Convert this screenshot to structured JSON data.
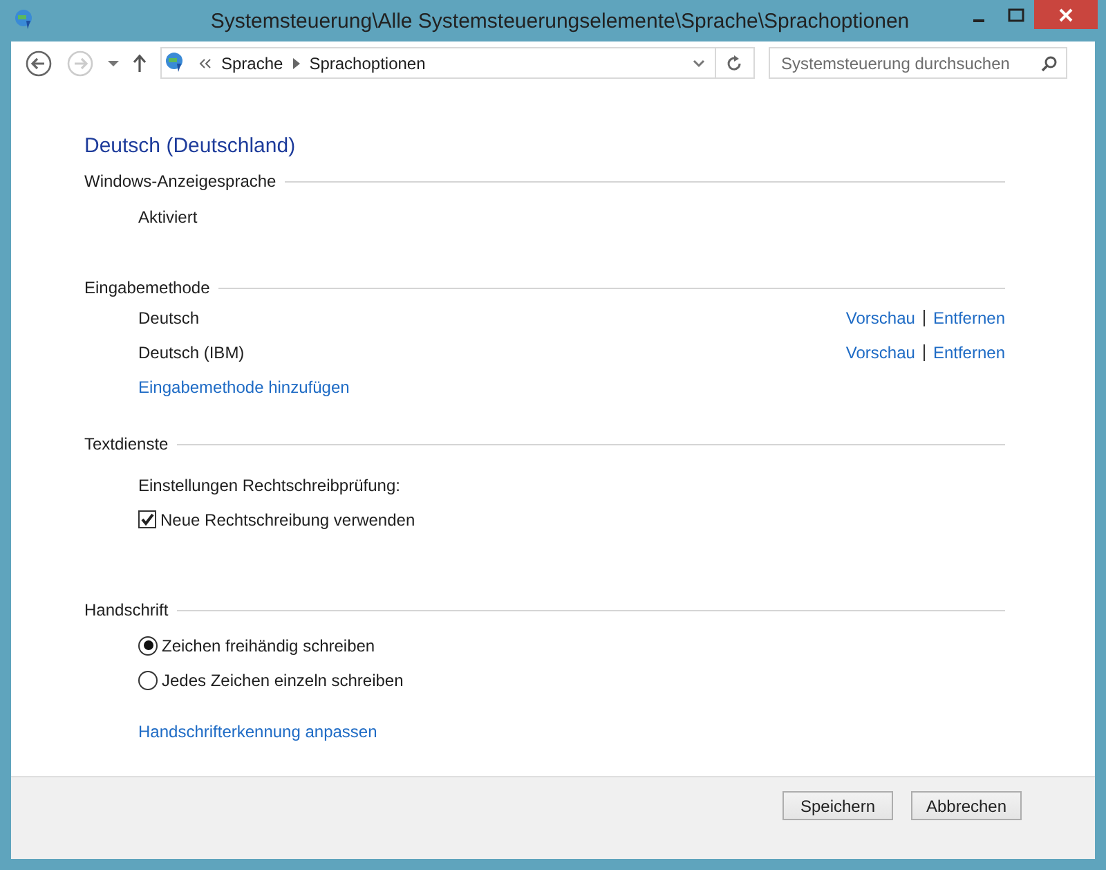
{
  "window": {
    "title": "Systemsteuerung\\Alle Systemsteuerungselemente\\Sprache\\Sprachoptionen"
  },
  "nav": {
    "breadcrumb": [
      "Sprache",
      "Sprachoptionen"
    ],
    "search": {
      "placeholder": "Systemsteuerung durchsuchen"
    }
  },
  "heading": "Deutsch (Deutschland)",
  "sections": [
    {
      "title": "Windows-Anzeigesprache",
      "items": [
        {
          "kind": "text",
          "text": "Aktiviert"
        }
      ]
    },
    {
      "title": "Eingabemethode",
      "items": [
        {
          "kind": "method",
          "text": "Deutsch",
          "actions": [
            "Vorschau",
            "Entfernen"
          ]
        },
        {
          "kind": "method",
          "text": "Deutsch (IBM)",
          "actions": [
            "Vorschau",
            "Entfernen"
          ]
        },
        {
          "kind": "link",
          "text": "Eingabemethode hinzufügen"
        }
      ]
    },
    {
      "title": "Textdienste",
      "items": [
        {
          "kind": "text",
          "text": "Einstellungen Rechtschreibprüfung:"
        },
        {
          "kind": "checkbox",
          "text": "Neue Rechtschreibung verwenden",
          "checked": true
        }
      ]
    },
    {
      "title": "Handschrift",
      "items": [
        {
          "kind": "radio",
          "text": "Zeichen freihändig schreiben",
          "selected": true
        },
        {
          "kind": "radio",
          "text": "Jedes Zeichen einzeln schreiben",
          "selected": false
        },
        {
          "kind": "link",
          "text": "Handschrifterkennung anpassen"
        }
      ]
    }
  ],
  "buttons": [
    "Speichern",
    "Abbrechen"
  ]
}
